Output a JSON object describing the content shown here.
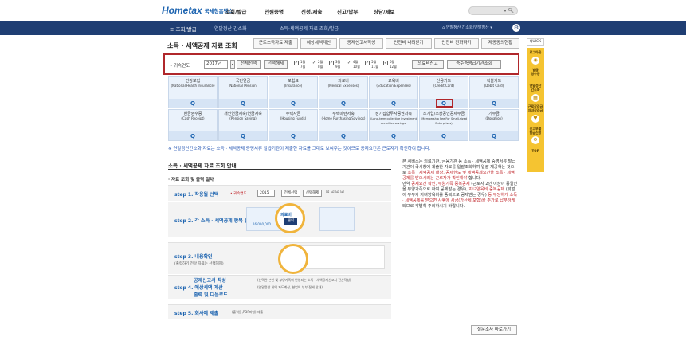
{
  "header": {
    "logo_text": "Hometax",
    "logo_sub": "국세청홈택스",
    "menu": [
      "조회/발급",
      "민원증명",
      "신청/제출",
      "신고/납부",
      "상담/제보"
    ],
    "search_icon": "search-icon"
  },
  "navbar": {
    "menu_label": "≡  조회/발급",
    "crumb1": "연말정산 간소화",
    "crumb2": "소득·세액공제 자료 조회/발급",
    "crumb_right": "⌂ 연말정산 간소화/연말정산 ▾"
  },
  "page": {
    "title": "소득 · 세액공제 자료 조회",
    "tabs": [
      "근로소득자료 제출",
      "예상세액계산",
      "공제신고서작성",
      "안전비 내려받기",
      "안전비 전화하기",
      "제공동의현황"
    ]
  },
  "filter": {
    "year_label": "• 귀속연도",
    "year_value": "2017년",
    "select_all": "전체선택",
    "select_clear": "선택해제",
    "months": [
      "1월",
      "2월",
      "3월",
      "4월",
      "5월",
      "6월",
      "7월",
      "8월",
      "9월",
      "10월",
      "11월",
      "12월"
    ],
    "btn_medical": "의료비신고",
    "btn_donation": "증수증명급기관조회"
  },
  "grid": {
    "row1": [
      {
        "ko": "건강보험",
        "en": "(National Health Insurance)"
      },
      {
        "ko": "국민연금",
        "en": "(National Pension)"
      },
      {
        "ko": "보험료",
        "en": "(Insurance)"
      },
      {
        "ko": "의료비",
        "en": "(Medical Expenses)"
      },
      {
        "ko": "교육비",
        "en": "(Education Expenses)"
      },
      {
        "ko": "신용카드",
        "en": "(Credit Card)"
      },
      {
        "ko": "직불카드",
        "en": "(Debit Card)"
      }
    ],
    "row2": [
      {
        "ko": "현금영수증",
        "en": "(Cash Receipt)"
      },
      {
        "ko": "개인연금저축/연금저축",
        "en": "(Pension Saving)"
      },
      {
        "ko": "주택자금",
        "en": "(Housing Funds)"
      },
      {
        "ko": "주택마련저축",
        "en": "(Home Purchasing Savings)"
      },
      {
        "ko": "장기집합투자증권저축",
        "en": "(Long-term collective investment securities savings)"
      },
      {
        "ko": "소기업/소상공인공제부금",
        "en": "(Membership Fee For Small-sized Enterprises)"
      },
      {
        "ko": "기부금",
        "en": "(Donation)"
      }
    ],
    "search_symbol": "Q"
  },
  "notice": "※ 연말정산간소화 자료는 소득 · 세액공제 증명서류 발급기관이 제출한 자료를 그대로 보여주는 것이므로 공제요건은 근로자가 확인하여 합니다.",
  "guide": {
    "title": "소득 · 세액공제 자료 조회 안내",
    "subtitle": "· 자료 조회 및 출력 절차",
    "step1": "step 1. 작용월 선택",
    "step1_year": "• 귀속연도",
    "step1_year_value": "2015",
    "step1_all": "전체선택",
    "step1_clear": "선택해제",
    "step2": "step 2. 각 소득 · 세액공제 항목 클릭",
    "step2_cell": "의료비",
    "step2_label": "클릭",
    "step2_amount": "16,000,000",
    "step3": "step 3. 내용확인",
    "step3_sub": "(출력하기 전달 자료는 선택해제)",
    "step4_a": "공제신고서 작성",
    "step4_b": "step 4. 예상세액 계산",
    "step4_c": "출력 및 다운로드",
    "step4_note1": "(선택한 본인 및 부양가족의 반영되는 소득 · 세액공제신고서 전산작성)",
    "step4_note2": "(연말정산 세액 자도계산, 현업의 부부 절세 안내)",
    "step5": "step 5. 회사에 제출",
    "step5_sub": "(출력물,PDF파일) 제출"
  },
  "side": {
    "p1_a": "본 서비스는 의료기관, 금융기관 등 소득 · 세액공제 증명서류 발급기관이 국세청에 제출한 자료를 일괄조회하여 일괄 제공하는 것으로",
    "p1_red": "소득 · 세액공제 대상, 공제한도 및 세액공제요건을 소득 · 세액공제를 받으시려는 근로자가 확인해야",
    "p1_b": "합니다.",
    "p2_a": "만약",
    "p2_red1": "공제요건 확인, 부양가족 중복공제",
    "p2_b": "(근로자 2인 이상이 동일인을 부양가족으로 하여 공제받는 경우),",
    "p2_red2": "자녀양육비 중복공제",
    "p2_c": "(맞벌이 부부가 자녀양육비를 중복으로 공제받는 경우)",
    "p2_red3": "등 부당하게 소득 · 세액공제를 받으면 사후에 세금(가산세 포함)을 추가로 납부하게",
    "p2_d": "되므로 각별히 주의하시기 바랍니다."
  },
  "bottom_button": "설문조사 바로가기",
  "quick": {
    "head": "QUICK",
    "items": [
      "로그아웃",
      "발급\n영수증",
      "연말정산\n간소화",
      "근로장려금\n자녀장려금",
      "신고부를\n발급신청"
    ],
    "top": "TOP"
  }
}
